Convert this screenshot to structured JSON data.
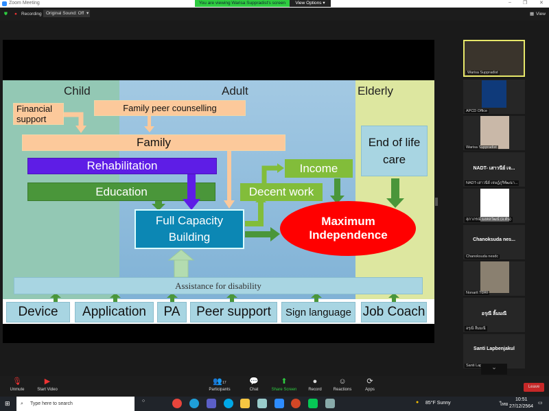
{
  "window": {
    "title": "Zoom Meeting",
    "banner": "You are viewing Warisa Suppradist's screen",
    "view_options": "View Options",
    "min": "–",
    "max": "❐",
    "close": "✕"
  },
  "topbar": {
    "recording": "Recording",
    "original_sound": "Original Sound: Off",
    "view": "View"
  },
  "slide": {
    "columns": {
      "child": "Child",
      "adult": "Adult",
      "elderly": "Elderly"
    },
    "financial_support": "Financial support",
    "family_peer": "Family peer counselling",
    "family": "Family",
    "rehabilitation": "Rehabilitation",
    "education": "Education",
    "full_capacity": "Full Capacity Building",
    "decent_work": "Decent work",
    "income": "Income",
    "max_independence": "Maximum Independence",
    "end_of_life": "End of life care",
    "assistance": "Assistance for disability",
    "supports": [
      "Device",
      "Application",
      "PA",
      "Peer support",
      "Sign language",
      "Job Coach"
    ],
    "colors": {
      "child": "#93c8b4",
      "adult": "#8fbddb",
      "elderly": "#dde7a0",
      "peach": "#fcc99b",
      "purple": "#5e1de6",
      "green": "#4a963a",
      "lightgreen": "#82bd3a",
      "blue": "#0c87b4",
      "red": "#ff0000"
    }
  },
  "participants": [
    {
      "name": "Warisa Suppradist",
      "active": true
    },
    {
      "name": "APCD Office"
    },
    {
      "name": "Warisa Suppradist"
    },
    {
      "name": "NADT-เสาวนีย์ เจษฎ์ภูริพัฒนา...",
      "label": "NADT- เสาวนีย์ เจ..."
    },
    {
      "name": "สุภาภรณ์ มงคลวัฒน์ (อ.ต้น)"
    },
    {
      "name": "Chanoksuda nesdc",
      "label": "Chanoksuda  nes..."
    },
    {
      "name": "Nonarit TDRI"
    },
    {
      "name": "อรุณี ลิ้มมณี",
      "label": "อรุณี ลิ้มมณี"
    },
    {
      "name": "Santi Lapbenjakul",
      "label": "Santi Lapbenjakul"
    }
  ],
  "toolbar": {
    "unmute": "Unmute",
    "start_video": "Start Video",
    "participants": "Participants",
    "participants_count": "17",
    "chat": "Chat",
    "share_screen": "Share Screen",
    "record": "Record",
    "reactions": "Reactions",
    "apps": "Apps",
    "leave": "Leave"
  },
  "taskbar": {
    "search_placeholder": "Type here to search",
    "weather": "85°F  Sunny",
    "lang": "ไทย",
    "time": "10:51",
    "date": "27/12/2564"
  }
}
